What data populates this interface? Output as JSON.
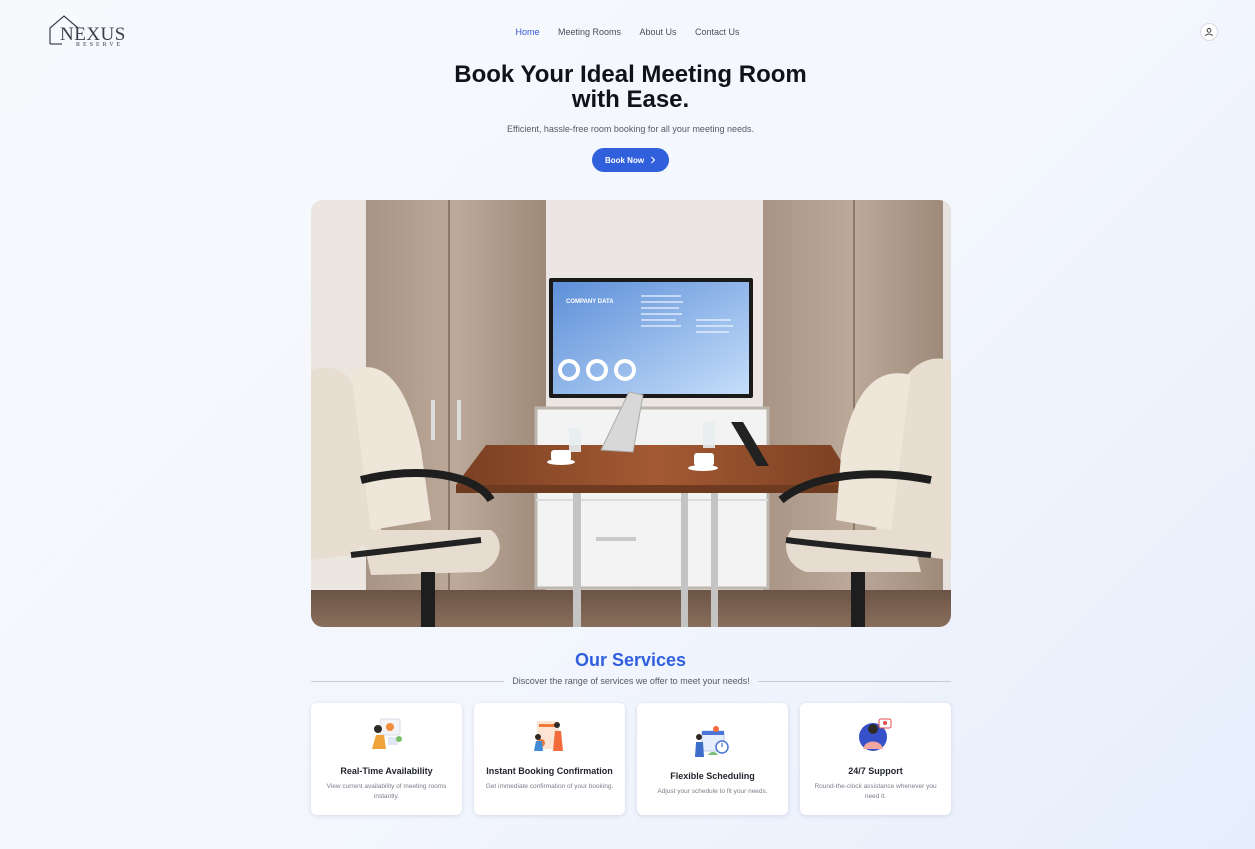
{
  "logo": {
    "brand": "NEXUS",
    "sub": "RESERVE"
  },
  "nav": {
    "items": [
      {
        "label": "Home",
        "active": true
      },
      {
        "label": "Meeting Rooms"
      },
      {
        "label": "About Us"
      },
      {
        "label": "Contact Us"
      }
    ]
  },
  "hero": {
    "title_line1": "Book Your Ideal Meeting Room",
    "title_line2": "with Ease.",
    "subtitle": "Efficient, hassle-free room booking for all your meeting needs.",
    "cta_label": "Book Now",
    "screen_text": "COMPANY DATA"
  },
  "services": {
    "title": "Our Services",
    "subtitle": "Discover the range of services we offer to meet your needs!",
    "cards": [
      {
        "icon": "availability-illustration",
        "title": "Real-Time Availability",
        "desc": "View current availability of meeting rooms instantly."
      },
      {
        "icon": "booking-illustration",
        "title": "Instant Booking Confirmation",
        "desc": "Get immediate confirmation of your booking."
      },
      {
        "icon": "scheduling-illustration",
        "title": "Flexible Scheduling",
        "desc": "Adjust your schedule to fit your needs."
      },
      {
        "icon": "support-illustration",
        "title": "24/7 Support",
        "desc": "Round-the-clock assistance whenever you need it."
      }
    ]
  },
  "colors": {
    "accent": "#3160dd",
    "nav_active": "#3a56d4"
  }
}
